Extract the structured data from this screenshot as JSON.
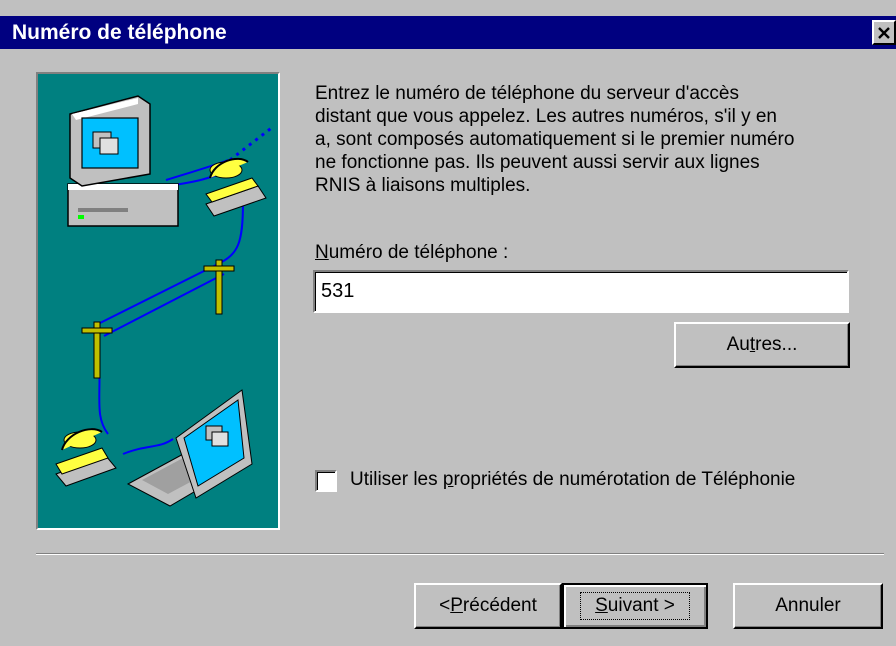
{
  "window": {
    "title": "Numéro de téléphone"
  },
  "instructions": "Entrez le numéro de téléphone du serveur d'accès\ndistant que vous appelez. Les autres numéros, s'il y en\na, sont composés automatiquement si le premier numéro\nne fonctionne pas. Ils peuvent aussi servir aux lignes\nRNIS à liaisons multiples.",
  "phone_field": {
    "label_mnemonic": "N",
    "label_rest": "uméro de téléphone :",
    "value": "531"
  },
  "buttons": {
    "autres_pre": "Au",
    "autres_mnemonic": "t",
    "autres_post": "res...",
    "back_pre": "< ",
    "back_mnemonic": "P",
    "back_post": "récédent",
    "next_mnemonic": "S",
    "next_post": "uivant >",
    "cancel": "Annuler"
  },
  "checkbox": {
    "label_pre": "Utiliser les ",
    "label_mnemonic": "p",
    "label_post": "ropriétés de numérotation de Téléphonie",
    "checked": false
  },
  "colors": {
    "titlebar": "#000080",
    "face": "#c0c0c0",
    "illustration_bg": "#008080"
  },
  "icons": {
    "close": "close-icon",
    "illustration": "dialup-network-illustration"
  }
}
